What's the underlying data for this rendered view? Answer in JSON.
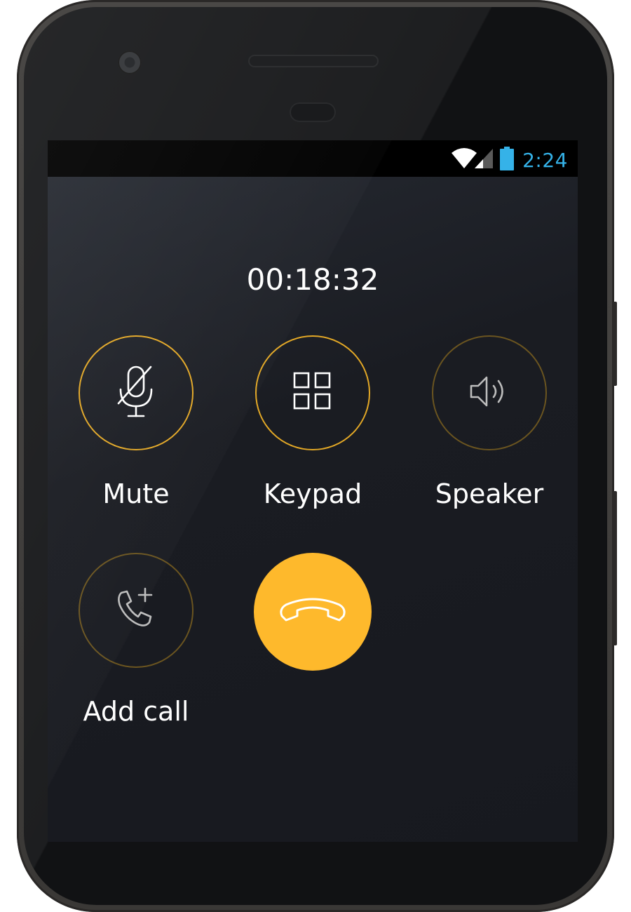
{
  "status_bar": {
    "time": "2:24",
    "icons": [
      "wifi-icon",
      "signal-icon",
      "battery-icon"
    ],
    "time_color": "#35b2e8"
  },
  "call": {
    "duration": "00:18:32"
  },
  "actions": {
    "mute": {
      "label": "Mute",
      "icon": "mic-off-icon"
    },
    "keypad": {
      "label": "Keypad",
      "icon": "keypad-icon"
    },
    "speaker": {
      "label": "Speaker",
      "icon": "speaker-icon"
    },
    "add_call": {
      "label": "Add call",
      "icon": "add-call-icon"
    },
    "end_call": {
      "icon": "end-call-icon"
    }
  },
  "colors": {
    "accent": "#feb92c",
    "ring_active": "#e3a826",
    "ring_inactive": "#6b5520",
    "background": "#1a1c22"
  }
}
